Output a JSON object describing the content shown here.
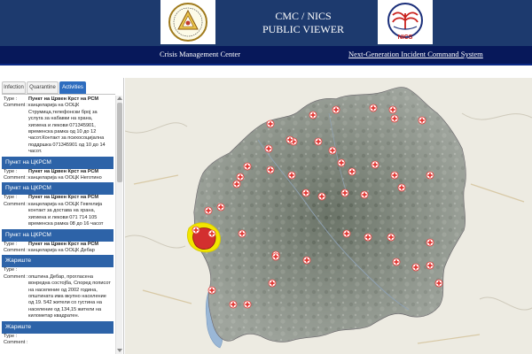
{
  "header": {
    "title_line1": "CMC / NICS",
    "title_line2": "PUBLIC VIEWER",
    "right_logo_text": "NICS"
  },
  "nav": {
    "left_link": "Crisis Management Center",
    "right_link": "Next-Generation Incident Command System"
  },
  "panel": {
    "tabs": [
      "Infection",
      "Quarantine",
      "Activities"
    ],
    "active_tab": "Activities",
    "type_label": "Type :",
    "comment_label": "Comment :",
    "entries": [
      {
        "header": "",
        "type": "Пункт на Црвен Крст на РСМ",
        "comment": "канцеларија на ООЦК Струмица,телефонски број за услуга за набавки на храна, хигиена и лекови 071345901, временска рамка од 10 до 12 часот.Контакт за психосоцијална поддршка 071345901 од 10 до 14 часот."
      },
      {
        "header": "Пункт на ЦКРСМ",
        "type": "Пункт на Црвен Крст на РСМ",
        "comment": "канцеларија на ООЦК Неготино"
      },
      {
        "header": "Пункт на ЦКРСМ",
        "type": "Пункт на Црвен Крст на РСМ",
        "comment": "канцеларија на ООЦК Гевгелија контакт за доставa на храна, хигиена и лекови 071 714 105 временска рамка 08 до 16 часот"
      },
      {
        "header": "Пункт на ЦКРСМ",
        "type": "Пункт на Црвен Крст на РСМ",
        "comment": "канцеларија на ООЦК Дебар"
      },
      {
        "header": "Жариште",
        "type": "",
        "comment": "општина Дебар, прогласена вонредна состојба, Според пописот на население од 2002 година, општината има вкупно население од 19. 542 жители со густина на население од 134,15 жители на километар квадратен."
      },
      {
        "header": "Жариште",
        "type": "",
        "comment": ""
      }
    ]
  },
  "colors": {
    "header_bg": "#1d3a6e",
    "nav_bg": "#07185a",
    "group_header_bg": "#2d63a8",
    "active_tab_bg": "#2e6dbf",
    "marker_red": "#e53935",
    "hotspot_red": "#d32f2f",
    "hotspot_yellow": "#f2e600"
  },
  "icons": {
    "left_logo": "crisis-management-center-emblem",
    "right_logo": "nics-emblem",
    "map_marker": "red-cross-marker-icon"
  }
}
